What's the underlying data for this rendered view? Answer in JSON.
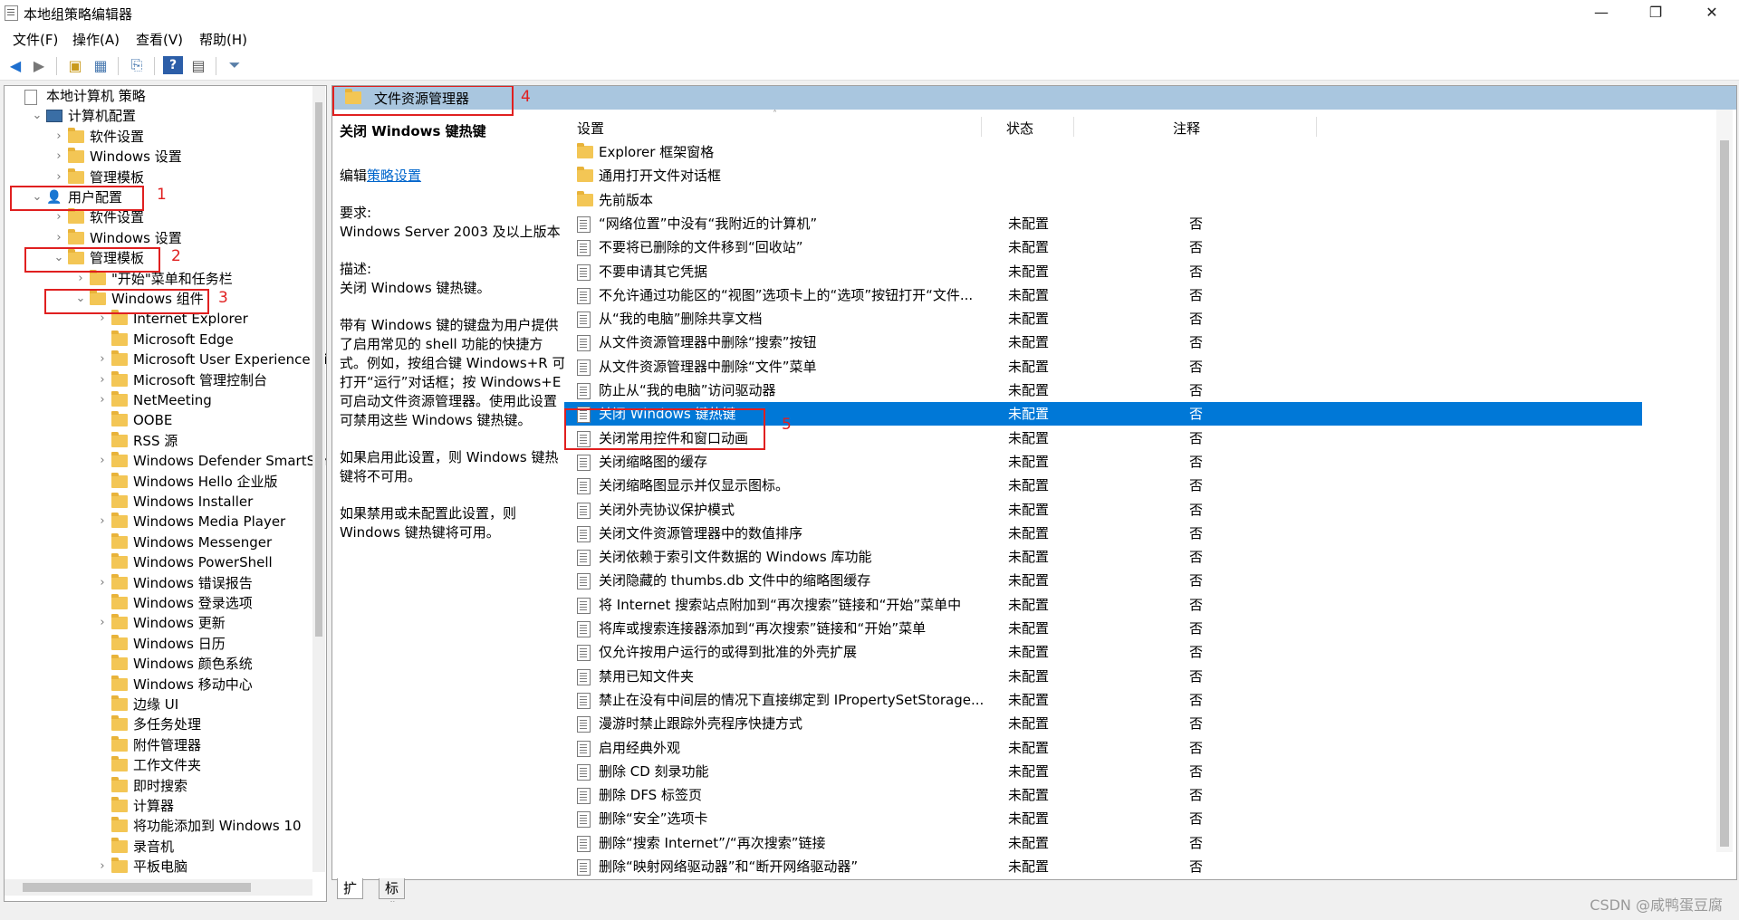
{
  "window": {
    "title": "本地组策略编辑器"
  },
  "menu": [
    "文件(F)",
    "操作(A)",
    "查看(V)",
    "帮助(H)"
  ],
  "tree": [
    {
      "label": "本地计算机 策略",
      "indent": 0,
      "chev": "",
      "icon": "policy"
    },
    {
      "label": "计算机配置",
      "indent": 1,
      "chev": "v",
      "icon": "computer"
    },
    {
      "label": "软件设置",
      "indent": 2,
      "chev": ">",
      "icon": "folder"
    },
    {
      "label": "Windows 设置",
      "indent": 2,
      "chev": ">",
      "icon": "folder"
    },
    {
      "label": "管理模板",
      "indent": 2,
      "chev": ">",
      "icon": "folder"
    },
    {
      "label": "用户配置",
      "indent": 1,
      "chev": "v",
      "icon": "user"
    },
    {
      "label": "软件设置",
      "indent": 2,
      "chev": ">",
      "icon": "folder"
    },
    {
      "label": "Windows 设置",
      "indent": 2,
      "chev": ">",
      "icon": "folder"
    },
    {
      "label": "管理模板",
      "indent": 2,
      "chev": "v",
      "icon": "folder"
    },
    {
      "label": "\"开始\"菜单和任务栏",
      "indent": 3,
      "chev": ">",
      "icon": "folder"
    },
    {
      "label": "Windows 组件",
      "indent": 3,
      "chev": "v",
      "icon": "folder"
    },
    {
      "label": "Internet Explorer",
      "indent": 4,
      "chev": ">",
      "icon": "folder"
    },
    {
      "label": "Microsoft Edge",
      "indent": 4,
      "chev": "",
      "icon": "folder"
    },
    {
      "label": "Microsoft User Experience Virtu",
      "indent": 4,
      "chev": ">",
      "icon": "folder"
    },
    {
      "label": "Microsoft 管理控制台",
      "indent": 4,
      "chev": ">",
      "icon": "folder"
    },
    {
      "label": "NetMeeting",
      "indent": 4,
      "chev": ">",
      "icon": "folder"
    },
    {
      "label": "OOBE",
      "indent": 4,
      "chev": "",
      "icon": "folder"
    },
    {
      "label": "RSS 源",
      "indent": 4,
      "chev": "",
      "icon": "folder"
    },
    {
      "label": "Windows Defender SmartScree",
      "indent": 4,
      "chev": ">",
      "icon": "folder"
    },
    {
      "label": "Windows Hello 企业版",
      "indent": 4,
      "chev": "",
      "icon": "folder"
    },
    {
      "label": "Windows Installer",
      "indent": 4,
      "chev": "",
      "icon": "folder"
    },
    {
      "label": "Windows Media Player",
      "indent": 4,
      "chev": ">",
      "icon": "folder"
    },
    {
      "label": "Windows Messenger",
      "indent": 4,
      "chev": "",
      "icon": "folder"
    },
    {
      "label": "Windows PowerShell",
      "indent": 4,
      "chev": "",
      "icon": "folder"
    },
    {
      "label": "Windows 错误报告",
      "indent": 4,
      "chev": ">",
      "icon": "folder"
    },
    {
      "label": "Windows 登录选项",
      "indent": 4,
      "chev": "",
      "icon": "folder"
    },
    {
      "label": "Windows 更新",
      "indent": 4,
      "chev": ">",
      "icon": "folder"
    },
    {
      "label": "Windows 日历",
      "indent": 4,
      "chev": "",
      "icon": "folder"
    },
    {
      "label": "Windows 颜色系统",
      "indent": 4,
      "chev": "",
      "icon": "folder"
    },
    {
      "label": "Windows 移动中心",
      "indent": 4,
      "chev": "",
      "icon": "folder"
    },
    {
      "label": "边缘 UI",
      "indent": 4,
      "chev": "",
      "icon": "folder"
    },
    {
      "label": "多任务处理",
      "indent": 4,
      "chev": "",
      "icon": "folder"
    },
    {
      "label": "附件管理器",
      "indent": 4,
      "chev": "",
      "icon": "folder"
    },
    {
      "label": "工作文件夹",
      "indent": 4,
      "chev": "",
      "icon": "folder"
    },
    {
      "label": "即时搜索",
      "indent": 4,
      "chev": "",
      "icon": "folder"
    },
    {
      "label": "计算器",
      "indent": 4,
      "chev": "",
      "icon": "folder"
    },
    {
      "label": "将功能添加到 Windows 10",
      "indent": 4,
      "chev": "",
      "icon": "folder"
    },
    {
      "label": "录音机",
      "indent": 4,
      "chev": "",
      "icon": "folder"
    },
    {
      "label": "平板电脑",
      "indent": 4,
      "chev": ">",
      "icon": "folder"
    }
  ],
  "annotations": [
    "1",
    "2",
    "3",
    "4",
    "5"
  ],
  "right": {
    "header": "文件资源管理器",
    "desc": {
      "title": "关闭 Windows 键热键",
      "edit_prefix": "编辑",
      "edit_link": "策略设置",
      "req_label": "要求:",
      "req_value": "Windows Server 2003 及以上版本",
      "desc_label": "描述:",
      "desc_value": "关闭 Windows 键热键。",
      "para1": "带有 Windows 键的键盘为用户提供了启用常见的 shell 功能的快捷方式。例如，按组合键 Windows+R 可打开“运行”对话框；按 Windows+E 可启动文件资源管理器。使用此设置可禁用这些 Windows 键热键。",
      "para2": "如果启用此设置，则 Windows 键热键将不可用。",
      "para3": "如果禁用或未配置此设置，则 Windows 键热键将可用。"
    },
    "columns": {
      "setting": "设置",
      "state": "状态",
      "note": "注释"
    },
    "folders": [
      "Explorer 框架窗格",
      "通用打开文件对话框",
      "先前版本"
    ],
    "rows": [
      {
        "name": "“网络位置”中没有“我附近的计算机”",
        "state": "未配置",
        "note": "否"
      },
      {
        "name": "不要将已删除的文件移到“回收站”",
        "state": "未配置",
        "note": "否"
      },
      {
        "name": "不要申请其它凭据",
        "state": "未配置",
        "note": "否"
      },
      {
        "name": "不允许通过功能区的“视图”选项卡上的“选项”按钮打开“文件...",
        "state": "未配置",
        "note": "否"
      },
      {
        "name": "从“我的电脑”删除共享文档",
        "state": "未配置",
        "note": "否"
      },
      {
        "name": "从文件资源管理器中删除“搜索”按钮",
        "state": "未配置",
        "note": "否"
      },
      {
        "name": "从文件资源管理器中删除“文件”菜单",
        "state": "未配置",
        "note": "否"
      },
      {
        "name": "防止从“我的电脑”访问驱动器",
        "state": "未配置",
        "note": "否"
      },
      {
        "name": "关闭 Windows 键热键",
        "state": "未配置",
        "note": "否",
        "selected": true
      },
      {
        "name": "关闭常用控件和窗口动画",
        "state": "未配置",
        "note": "否"
      },
      {
        "name": "关闭缩略图的缓存",
        "state": "未配置",
        "note": "否"
      },
      {
        "name": "关闭缩略图显示并仅显示图标。",
        "state": "未配置",
        "note": "否"
      },
      {
        "name": "关闭外壳协议保护模式",
        "state": "未配置",
        "note": "否"
      },
      {
        "name": "关闭文件资源管理器中的数值排序",
        "state": "未配置",
        "note": "否"
      },
      {
        "name": "关闭依赖于索引文件数据的 Windows 库功能",
        "state": "未配置",
        "note": "否"
      },
      {
        "name": "关闭隐藏的 thumbs.db 文件中的缩略图缓存",
        "state": "未配置",
        "note": "否"
      },
      {
        "name": "将 Internet 搜索站点附加到“再次搜索”链接和“开始”菜单中",
        "state": "未配置",
        "note": "否"
      },
      {
        "name": "将库或搜索连接器添加到“再次搜索”链接和“开始”菜单",
        "state": "未配置",
        "note": "否"
      },
      {
        "name": "仅允许按用户运行的或得到批准的外壳扩展",
        "state": "未配置",
        "note": "否"
      },
      {
        "name": "禁用已知文件夹",
        "state": "未配置",
        "note": "否"
      },
      {
        "name": "禁止在没有中间层的情况下直接绑定到 IPropertySetStorage...",
        "state": "未配置",
        "note": "否"
      },
      {
        "name": "漫游时禁止跟踪外壳程序快捷方式",
        "state": "未配置",
        "note": "否"
      },
      {
        "name": "启用经典外观",
        "state": "未配置",
        "note": "否"
      },
      {
        "name": "删除 CD 刻录功能",
        "state": "未配置",
        "note": "否"
      },
      {
        "name": "删除 DFS 标签页",
        "state": "未配置",
        "note": "否"
      },
      {
        "name": "删除“安全”选项卡",
        "state": "未配置",
        "note": "否"
      },
      {
        "name": "删除“搜索 Internet”/“再次搜索”链接",
        "state": "未配置",
        "note": "否"
      },
      {
        "name": "删除“映射网络驱动器”和“断开网络驱动器”",
        "state": "未配置",
        "note": "否"
      }
    ]
  },
  "tabs": [
    "扩展",
    "标准"
  ],
  "watermark": "CSDN @咸鸭蛋豆腐",
  "colors": {
    "selection": "#0078d7",
    "header": "#a9c6df",
    "annotation": "#e02020"
  }
}
